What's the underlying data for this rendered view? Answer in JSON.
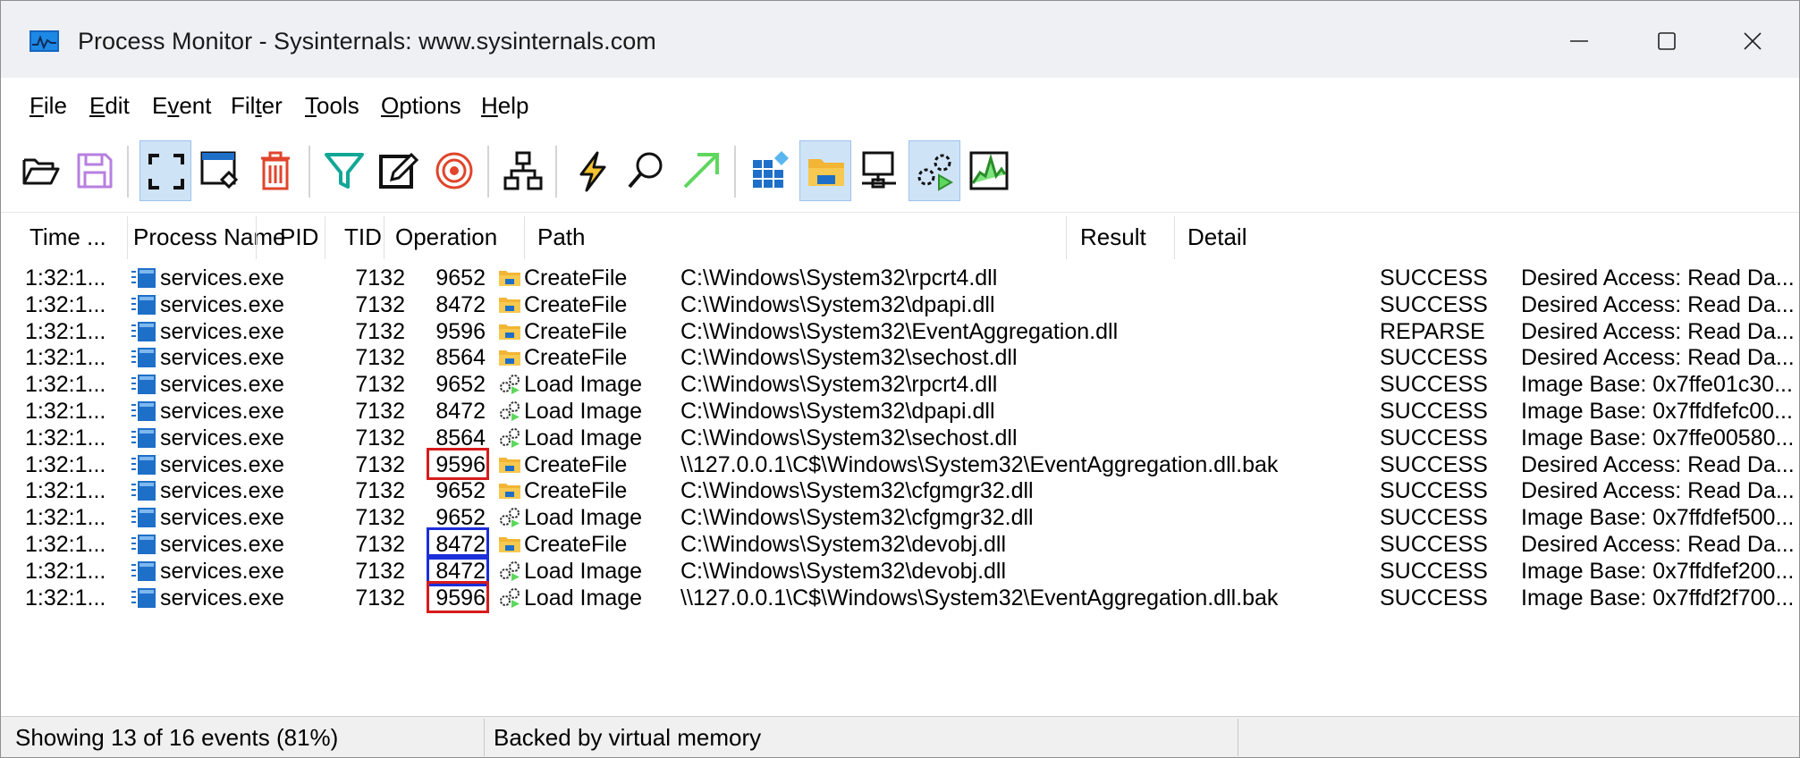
{
  "window": {
    "title": "Process Monitor - Sysinternals: www.sysinternals.com",
    "controls": [
      "minimize",
      "maximize",
      "close"
    ]
  },
  "menu": [
    {
      "pre": "",
      "u": "F",
      "post": "ile"
    },
    {
      "pre": "",
      "u": "E",
      "post": "dit"
    },
    {
      "pre": "E",
      "u": "v",
      "post": "ent"
    },
    {
      "pre": "Fil",
      "u": "t",
      "post": "er"
    },
    {
      "pre": "",
      "u": "T",
      "post": "ools"
    },
    {
      "pre": "",
      "u": "O",
      "post": "ptions"
    },
    {
      "pre": "",
      "u": "H",
      "post": "elp"
    }
  ],
  "toolbar": {
    "buttons": [
      {
        "icon": "open-folder-icon",
        "active": false
      },
      {
        "icon": "save-icon",
        "active": false
      },
      {
        "icon": "capture-icon",
        "active": true
      },
      {
        "icon": "autoscroll-icon",
        "active": false
      },
      {
        "icon": "clear-icon",
        "active": false
      },
      {
        "icon": "filter-icon",
        "active": false
      },
      {
        "icon": "highlight-icon",
        "active": false
      },
      {
        "icon": "target-icon",
        "active": false
      },
      {
        "icon": "process-tree-icon",
        "active": false
      },
      {
        "icon": "event-properties-icon",
        "active": false
      },
      {
        "icon": "find-icon",
        "active": false
      },
      {
        "icon": "jump-to-icon",
        "active": false
      },
      {
        "icon": "show-registry-icon",
        "active": false
      },
      {
        "icon": "show-filesystem-icon",
        "active": true
      },
      {
        "icon": "show-network-icon",
        "active": false
      },
      {
        "icon": "show-process-thread-icon",
        "active": true
      },
      {
        "icon": "show-profiling-icon",
        "active": false
      }
    ]
  },
  "columns": {
    "time": "Time ...",
    "process": "Process Name",
    "pid": "PID",
    "tid": "TID",
    "operation": "Operation",
    "path": "Path",
    "result": "Result",
    "detail": "Detail"
  },
  "rows": [
    {
      "time": "1:32:1...",
      "process": "services.exe",
      "pid": "7132",
      "tid": "9652",
      "op_icon": "folder-icon",
      "operation": "CreateFile",
      "path": "C:\\Windows\\System32\\rpcrt4.dll",
      "result": "SUCCESS",
      "detail": "Desired Access: Read Da...",
      "highlight": ""
    },
    {
      "time": "1:32:1...",
      "process": "services.exe",
      "pid": "7132",
      "tid": "8472",
      "op_icon": "folder-icon",
      "operation": "CreateFile",
      "path": "C:\\Windows\\System32\\dpapi.dll",
      "result": "SUCCESS",
      "detail": "Desired Access: Read Da...",
      "highlight": ""
    },
    {
      "time": "1:32:1...",
      "process": "services.exe",
      "pid": "7132",
      "tid": "9596",
      "op_icon": "folder-icon",
      "operation": "CreateFile",
      "path": "C:\\Windows\\System32\\EventAggregation.dll",
      "result": "REPARSE",
      "detail": "Desired Access: Read Da...",
      "highlight": ""
    },
    {
      "time": "1:32:1...",
      "process": "services.exe",
      "pid": "7132",
      "tid": "8564",
      "op_icon": "folder-icon",
      "operation": "CreateFile",
      "path": "C:\\Windows\\System32\\sechost.dll",
      "result": "SUCCESS",
      "detail": "Desired Access: Read Da...",
      "highlight": ""
    },
    {
      "time": "1:32:1...",
      "process": "services.exe",
      "pid": "7132",
      "tid": "9652",
      "op_icon": "gears-icon",
      "operation": "Load Image",
      "path": "C:\\Windows\\System32\\rpcrt4.dll",
      "result": "SUCCESS",
      "detail": "Image Base: 0x7ffe01c30...",
      "highlight": ""
    },
    {
      "time": "1:32:1...",
      "process": "services.exe",
      "pid": "7132",
      "tid": "8472",
      "op_icon": "gears-icon",
      "operation": "Load Image",
      "path": "C:\\Windows\\System32\\dpapi.dll",
      "result": "SUCCESS",
      "detail": "Image Base: 0x7ffdfefc00...",
      "highlight": ""
    },
    {
      "time": "1:32:1...",
      "process": "services.exe",
      "pid": "7132",
      "tid": "8564",
      "op_icon": "gears-icon",
      "operation": "Load Image",
      "path": "C:\\Windows\\System32\\sechost.dll",
      "result": "SUCCESS",
      "detail": "Image Base: 0x7ffe00580...",
      "highlight": ""
    },
    {
      "time": "1:32:1...",
      "process": "services.exe",
      "pid": "7132",
      "tid": "9596",
      "op_icon": "folder-icon",
      "operation": "CreateFile",
      "path": "\\\\127.0.0.1\\C$\\Windows\\System32\\EventAggregation.dll.bak",
      "result": "SUCCESS",
      "detail": "Desired Access: Read Da...",
      "highlight": "red"
    },
    {
      "time": "1:32:1...",
      "process": "services.exe",
      "pid": "7132",
      "tid": "9652",
      "op_icon": "folder-icon",
      "operation": "CreateFile",
      "path": "C:\\Windows\\System32\\cfgmgr32.dll",
      "result": "SUCCESS",
      "detail": "Desired Access: Read Da...",
      "highlight": ""
    },
    {
      "time": "1:32:1...",
      "process": "services.exe",
      "pid": "7132",
      "tid": "9652",
      "op_icon": "gears-icon",
      "operation": "Load Image",
      "path": "C:\\Windows\\System32\\cfgmgr32.dll",
      "result": "SUCCESS",
      "detail": "Image Base: 0x7ffdfef500...",
      "highlight": ""
    },
    {
      "time": "1:32:1...",
      "process": "services.exe",
      "pid": "7132",
      "tid": "8472",
      "op_icon": "folder-icon",
      "operation": "CreateFile",
      "path": "C:\\Windows\\System32\\devobj.dll",
      "result": "SUCCESS",
      "detail": "Desired Access: Read Da...",
      "highlight": "blue"
    },
    {
      "time": "1:32:1...",
      "process": "services.exe",
      "pid": "7132",
      "tid": "8472",
      "op_icon": "gears-icon",
      "operation": "Load Image",
      "path": "C:\\Windows\\System32\\devobj.dll",
      "result": "SUCCESS",
      "detail": "Image Base: 0x7ffdfef200...",
      "highlight": "blue"
    },
    {
      "time": "1:32:1...",
      "process": "services.exe",
      "pid": "7132",
      "tid": "9596",
      "op_icon": "gears-icon",
      "operation": "Load Image",
      "path": "\\\\127.0.0.1\\C$\\Windows\\System32\\EventAggregation.dll.bak",
      "result": "SUCCESS",
      "detail": "Image Base: 0x7ffdf2f700...",
      "highlight": "red"
    }
  ],
  "status": {
    "events": "Showing 13 of 16 events (81%)",
    "memory": "Backed by virtual memory"
  },
  "colors": {
    "highlight_red": "#d81b1b",
    "highlight_blue": "#1b2fd8",
    "active_button": "#cfe3f7"
  }
}
